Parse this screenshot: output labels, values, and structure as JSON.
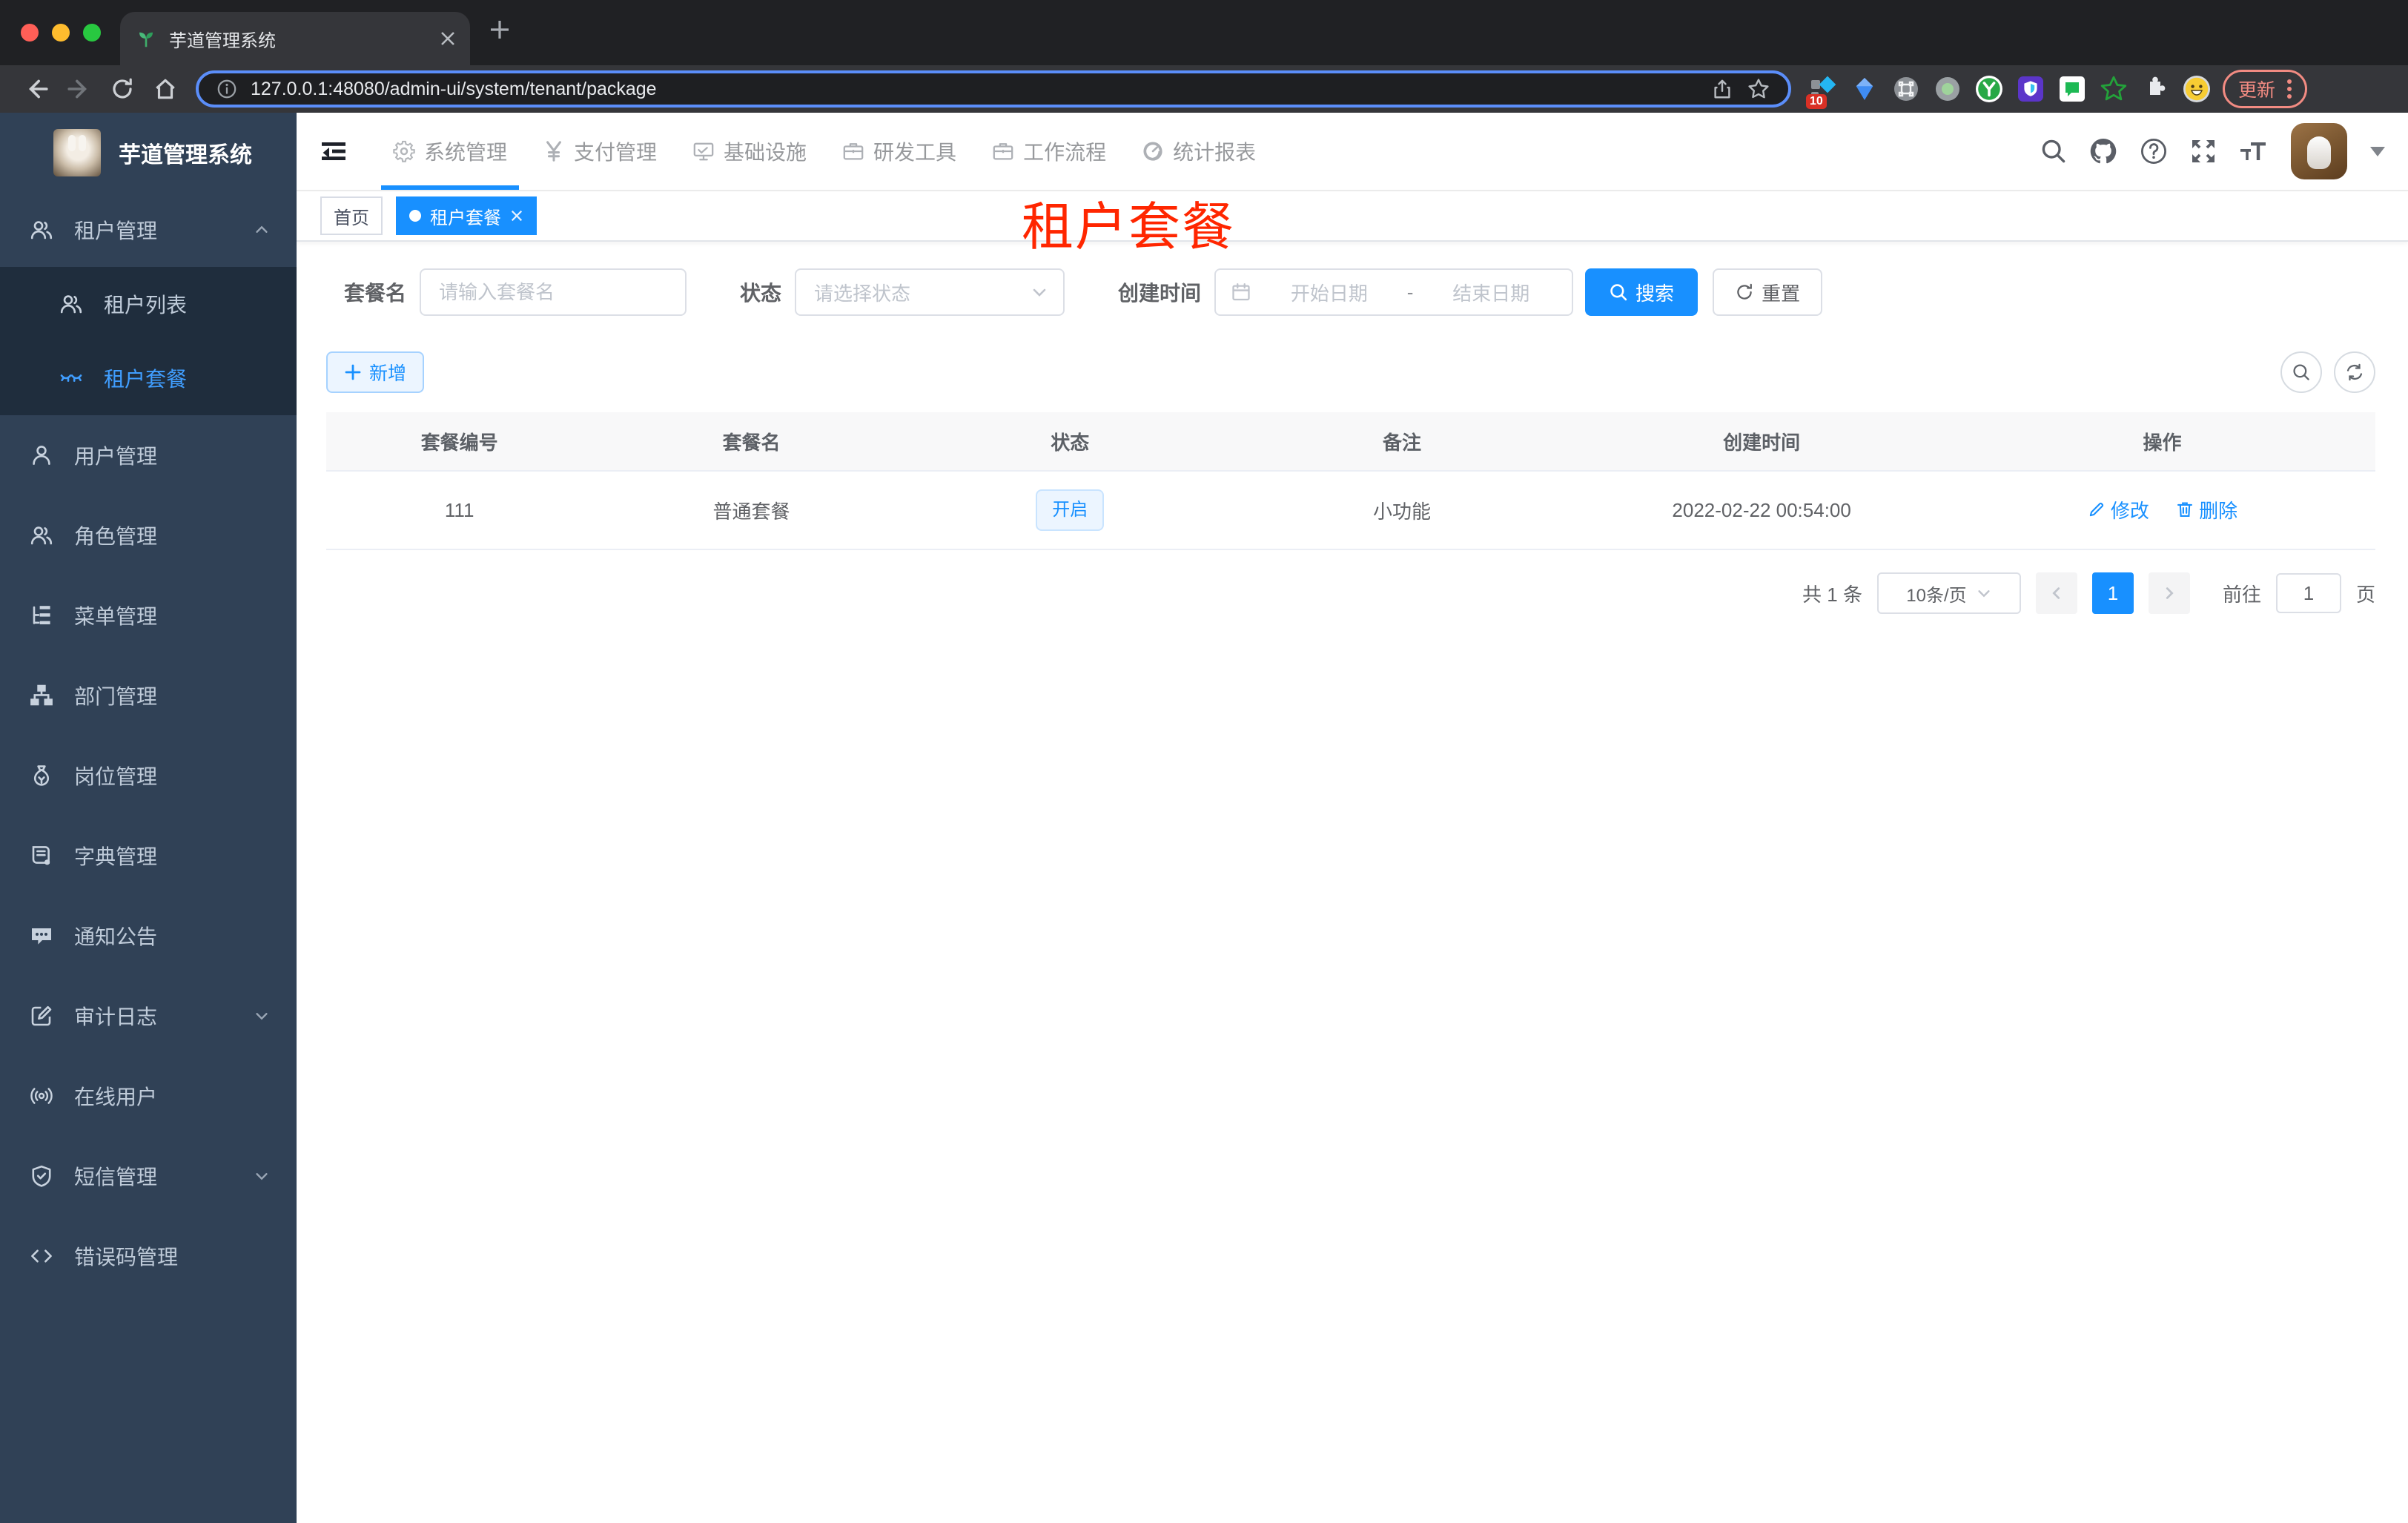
{
  "browser": {
    "tab_title": "芋道管理系统",
    "url": "127.0.0.1:48080/admin-ui/system/tenant/package",
    "extension_badge": "10",
    "update_label": "更新"
  },
  "app": {
    "logo_title": "芋道管理系统",
    "topnav": [
      {
        "label": "系统管理",
        "icon": "gear-icon",
        "active": true
      },
      {
        "label": "支付管理",
        "icon": "yen-icon",
        "active": false
      },
      {
        "label": "基础设施",
        "icon": "monitor-icon",
        "active": false
      },
      {
        "label": "研发工具",
        "icon": "briefcase-icon",
        "active": false
      },
      {
        "label": "工作流程",
        "icon": "briefcase-icon",
        "active": false
      },
      {
        "label": "统计报表",
        "icon": "gauge-icon",
        "active": false
      }
    ],
    "sidebar": {
      "items": [
        {
          "label": "租户管理",
          "icon": "people-icon",
          "expanded": true,
          "children": [
            {
              "label": "租户列表",
              "icon": "people-icon",
              "active": false
            },
            {
              "label": "租户套餐",
              "icon": "eye-closed-icon",
              "active": true
            }
          ]
        },
        {
          "label": "用户管理",
          "icon": "user-icon"
        },
        {
          "label": "角色管理",
          "icon": "people-icon"
        },
        {
          "label": "菜单管理",
          "icon": "tree-list-icon"
        },
        {
          "label": "部门管理",
          "icon": "org-tree-icon"
        },
        {
          "label": "岗位管理",
          "icon": "money-bag-icon"
        },
        {
          "label": "字典管理",
          "icon": "dictionary-icon"
        },
        {
          "label": "通知公告",
          "icon": "message-icon"
        },
        {
          "label": "审计日志",
          "icon": "pen-square-icon",
          "collapsed": true
        },
        {
          "label": "在线用户",
          "icon": "online-signal-icon"
        },
        {
          "label": "短信管理",
          "icon": "shield-check-icon",
          "collapsed": true
        },
        {
          "label": "错误码管理",
          "icon": "code-icon"
        }
      ]
    },
    "tags": [
      {
        "label": "首页",
        "active": false
      },
      {
        "label": "租户套餐",
        "active": true
      }
    ],
    "annotation": "租户套餐",
    "filter": {
      "name_label": "套餐名",
      "name_placeholder": "请输入套餐名",
      "status_label": "状态",
      "status_placeholder": "请选择状态",
      "date_label": "创建时间",
      "date_start_placeholder": "开始日期",
      "date_separator": "-",
      "date_end_placeholder": "结束日期",
      "search_label": "搜索",
      "reset_label": "重置"
    },
    "toolbar": {
      "add_label": "新增"
    },
    "table": {
      "columns": [
        "套餐编号",
        "套餐名",
        "状态",
        "备注",
        "创建时间",
        "操作"
      ],
      "row": {
        "id": "111",
        "name": "普通套餐",
        "status": "开启",
        "remark": "小功能",
        "created": "2022-02-22 00:54:00"
      },
      "actions": {
        "edit": "修改",
        "delete": "删除"
      }
    },
    "pagination": {
      "total": "共 1 条",
      "page_size": "10条/页",
      "page": "1",
      "goto_label": "前往",
      "goto_value": "1",
      "unit": "页"
    },
    "colors": {
      "primary": "#1890ff",
      "sidebar_bg": "#304156",
      "submenu_bg": "#1f2d3d",
      "sidebar_active_text": "#409eff",
      "annotation_red": "#ff2600",
      "status_tag_bg": "#ecf5ff"
    }
  }
}
